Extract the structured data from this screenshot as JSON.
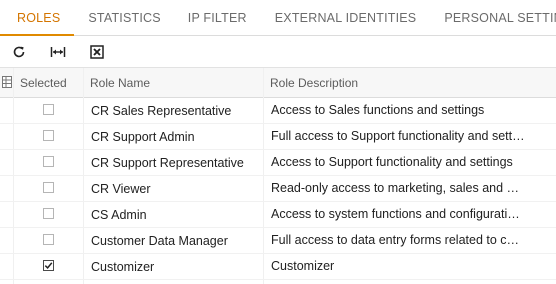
{
  "tabs": [
    {
      "label": "ROLES",
      "active": true
    },
    {
      "label": "STATISTICS",
      "active": false
    },
    {
      "label": "IP FILTER",
      "active": false
    },
    {
      "label": "EXTERNAL IDENTITIES",
      "active": false
    },
    {
      "label": "PERSONAL SETTINGS",
      "active": false
    }
  ],
  "toolbar": {
    "icons": [
      "refresh-icon",
      "fit-columns-icon",
      "export-excel-icon"
    ]
  },
  "grid": {
    "columns": {
      "selected": "Selected",
      "role_name": "Role Name",
      "role_description": "Role Description"
    },
    "rows": [
      {
        "selected": false,
        "name": "CR Sales Representative",
        "description": "Access to Sales functions and settings"
      },
      {
        "selected": false,
        "name": "CR Support Admin",
        "description": "Full access to Support functionality and settings"
      },
      {
        "selected": false,
        "name": "CR Support Representative",
        "description": "Access to Support functionality and settings"
      },
      {
        "selected": false,
        "name": "CR Viewer",
        "description": "Read-only access to marketing, sales and support functionality"
      },
      {
        "selected": false,
        "name": "CS Admin",
        "description": "Access to system functions and configuration including"
      },
      {
        "selected": false,
        "name": "Customer Data Manager",
        "description": "Full access to data entry forms related to customers"
      },
      {
        "selected": true,
        "name": "Customizer",
        "description": "Customizer"
      }
    ]
  },
  "colors": {
    "accent": "#e08a00",
    "accent_text": "#d47500"
  }
}
